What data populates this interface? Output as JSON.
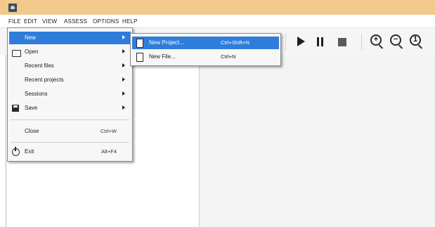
{
  "menubar": {
    "file": "FILE",
    "edit": "EDIT",
    "view": "VIEW",
    "assess": "ASSESS",
    "options": "OPTIONS",
    "help": "HELP"
  },
  "file_menu": {
    "new": "New",
    "open": "Open",
    "recent_files": "Recent files",
    "recent_projects": "Recent projects",
    "sessions": "Sessions",
    "save": "Save",
    "close": "Close",
    "close_shortcut": "Ctrl+W",
    "exit": "Exit",
    "exit_shortcut": "Alt+F4"
  },
  "new_submenu": {
    "new_project": "New Project...",
    "new_project_shortcut": "Ctrl+Shift+N",
    "new_file": "New File...",
    "new_file_shortcut": "Ctrl+N"
  },
  "toolbar": {
    "zoom_in_glyph": "+",
    "zoom_out_glyph": "−",
    "zoom_reset_glyph": "1"
  },
  "colors": {
    "titlebar": "#f2c98c",
    "highlight": "#2e7ddb"
  }
}
